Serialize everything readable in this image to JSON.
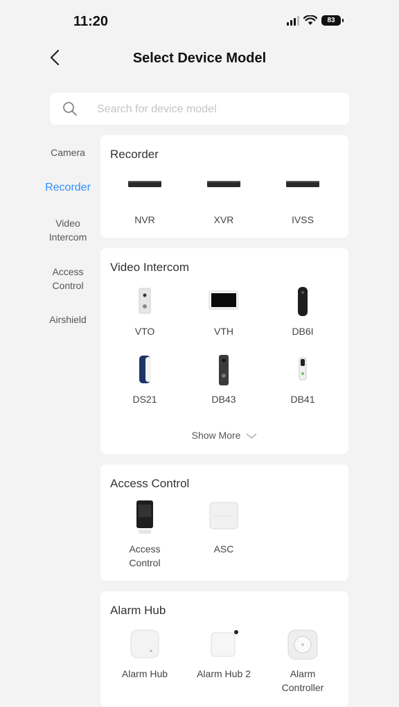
{
  "status_bar": {
    "time": "11:20",
    "battery": "83"
  },
  "nav": {
    "title": "Select Device Model"
  },
  "search": {
    "placeholder": "Search for device model"
  },
  "sidebar": {
    "items": [
      {
        "label": "Camera",
        "active": false
      },
      {
        "label": "Recorder",
        "active": true
      },
      {
        "label": "Video\nIntercom",
        "active": false
      },
      {
        "label": "Access\nControl",
        "active": false
      },
      {
        "label": "Airshield",
        "active": false
      }
    ]
  },
  "sections": [
    {
      "title": "Recorder",
      "devices": [
        {
          "label": "NVR"
        },
        {
          "label": "XVR"
        },
        {
          "label": "IVSS"
        }
      ]
    },
    {
      "title": "Video Intercom",
      "devices": [
        {
          "label": "VTO"
        },
        {
          "label": "VTH"
        },
        {
          "label": "DB6I"
        },
        {
          "label": "DS21"
        },
        {
          "label": "DB43"
        },
        {
          "label": "DB41"
        }
      ],
      "show_more": "Show More"
    },
    {
      "title": "Access Control",
      "devices": [
        {
          "label": "Access\nControl"
        },
        {
          "label": "ASC"
        }
      ]
    },
    {
      "title": "Alarm Hub",
      "devices": [
        {
          "label": "Alarm Hub"
        },
        {
          "label": "Alarm Hub 2"
        },
        {
          "label": "Alarm\nController"
        }
      ]
    }
  ],
  "colors": {
    "accent": "#2f8fff",
    "background": "#f3f3f3"
  }
}
